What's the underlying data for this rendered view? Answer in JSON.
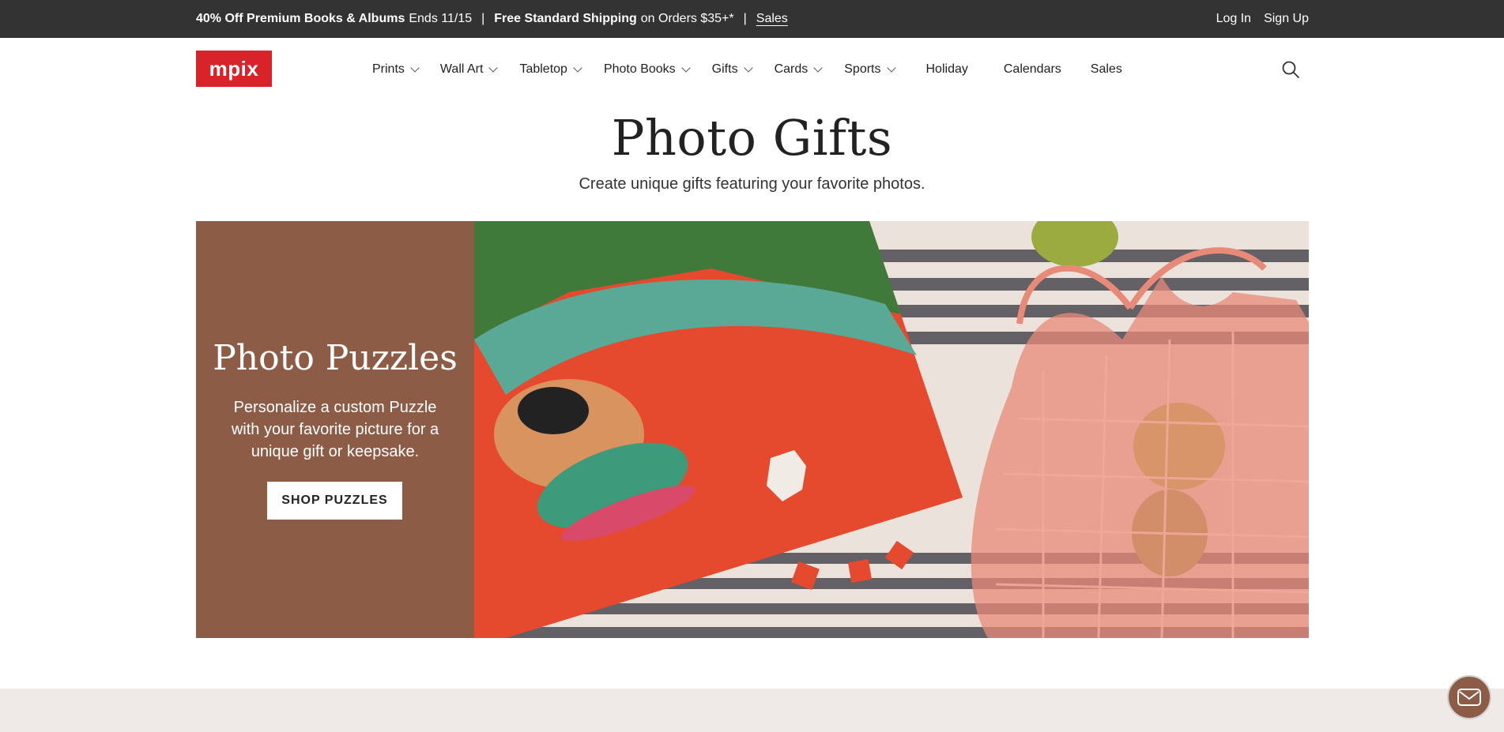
{
  "promo": {
    "offer_bold": "40% Off Premium Books & Albums",
    "offer_light": "Ends 11/15",
    "separator": "|",
    "shipping_bold": "Free Standard Shipping",
    "shipping_light": "on Orders $35+*",
    "sales_link": "Sales",
    "login": "Log In",
    "signup": "Sign Up"
  },
  "header": {
    "logo_text": "mpix",
    "nav": [
      {
        "label": "Prints",
        "has_dropdown": true
      },
      {
        "label": "Wall Art",
        "has_dropdown": true
      },
      {
        "label": "Tabletop",
        "has_dropdown": true
      },
      {
        "label": "Photo Books",
        "has_dropdown": true
      },
      {
        "label": "Gifts",
        "has_dropdown": true
      },
      {
        "label": "Cards",
        "has_dropdown": true
      },
      {
        "label": "Sports",
        "has_dropdown": true
      },
      {
        "label": "Holiday",
        "has_dropdown": false
      },
      {
        "label": "Calendars",
        "has_dropdown": false
      },
      {
        "label": "Sales",
        "has_dropdown": false
      }
    ],
    "search_icon": "search-icon"
  },
  "page": {
    "title": "Photo Gifts",
    "subtitle": "Create unique gifts featuring your favorite photos."
  },
  "hero": {
    "title": "Photo Puzzles",
    "description": "Personalize a custom Puzzle with your favorite picture for a unique gift or keepsake.",
    "button_label": "SHOP PUZZLES",
    "panel_color": "#8d5c47"
  },
  "colors": {
    "promo_bg": "#333333",
    "logo_red": "#d8232a",
    "band_bg": "#efe9e8"
  },
  "chat": {
    "icon": "mail-icon"
  }
}
